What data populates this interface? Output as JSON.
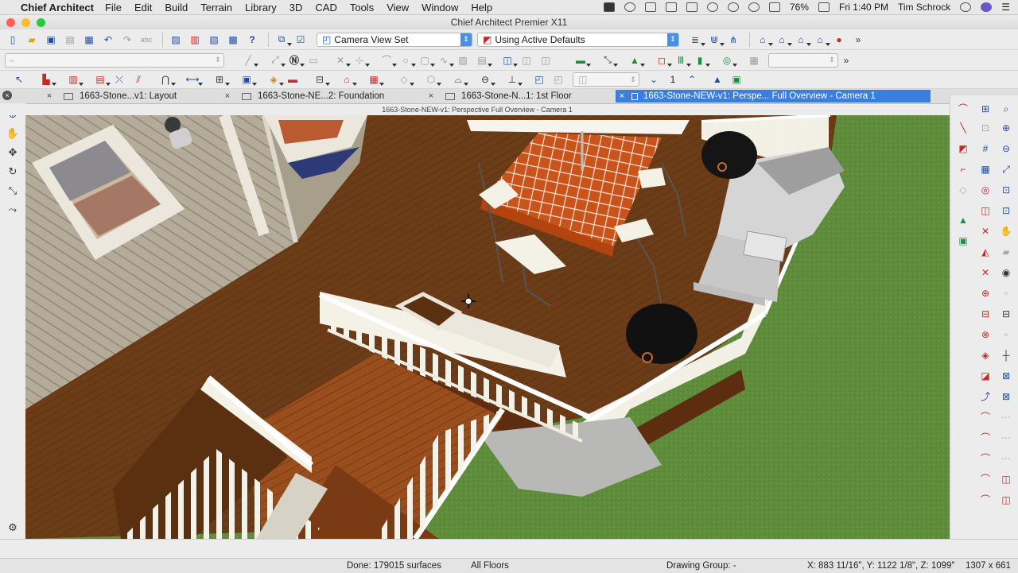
{
  "menubar": {
    "app_name": "Chief Architect",
    "items": [
      "File",
      "Edit",
      "Build",
      "Terrain",
      "Library",
      "3D",
      "CAD",
      "Tools",
      "View",
      "Window",
      "Help"
    ],
    "battery": "76%",
    "clock": "Fri 1:40 PM",
    "user": "Tim Schrock"
  },
  "window": {
    "title": "Chief Architect Premier X11"
  },
  "toolbar1": {
    "camera_view_set": "Camera View Set",
    "defaults_set": "Using Active Defaults"
  },
  "toolbar3": {
    "floor_number": "1"
  },
  "tabs": [
    {
      "label": "1663-Stone...v1: Layout"
    },
    {
      "label": "1663-Stone-NE...2: Foundation"
    },
    {
      "label": "1663-Stone-N...1: 1st Floor"
    },
    {
      "label": "1663-Stone-NEW-v1: Perspe... Full Overview - Camera 1"
    }
  ],
  "viewport": {
    "title": "1663-Stone-NEW-v1: Perspective Full Overview - Camera 1"
  },
  "status": {
    "done": "Done:  179015 surfaces",
    "floors": "All Floors",
    "drawing_group": "Drawing Group: -",
    "coords": "X: 883 11/16\", Y: 1122 1/8\", Z: 1099\"",
    "size": "1307 x 661"
  },
  "colors": {
    "accent": "#3b7ee0",
    "deck": "#6b3c17",
    "grass": "#5c8a3a",
    "siding": "#b3ab98",
    "railing": "#f2efe4",
    "table_tile": "#c9531a"
  }
}
